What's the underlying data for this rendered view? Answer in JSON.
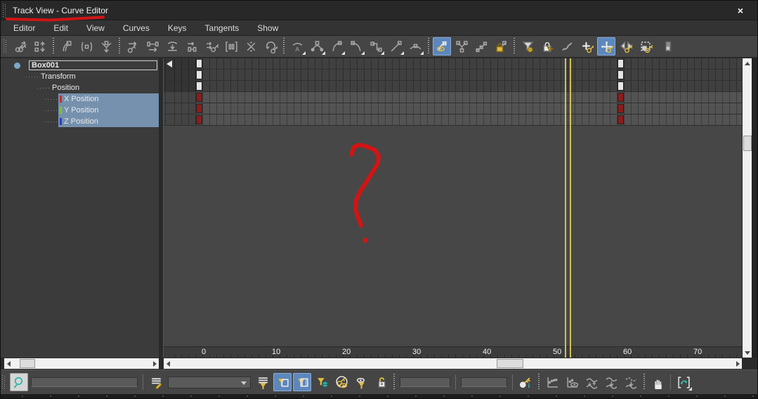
{
  "window": {
    "title": "Track View - Curve Editor",
    "close_label": "×"
  },
  "menu": {
    "items": [
      "Editor",
      "Edit",
      "View",
      "Curves",
      "Keys",
      "Tangents",
      "Show"
    ]
  },
  "toolbar_top": {
    "items": [
      {
        "t": "grip"
      },
      {
        "t": "btn",
        "name": "offset-keys",
        "icon": "key-arrow"
      },
      {
        "t": "btn",
        "name": "nudge-keys-vertical",
        "icon": "squares-ud"
      },
      {
        "t": "sep"
      },
      {
        "t": "btn",
        "name": "break-tangents-tool",
        "icon": "pliers"
      },
      {
        "t": "btn",
        "name": "snap-key-to-frame",
        "icon": "brace"
      },
      {
        "t": "btn",
        "name": "weld-keys",
        "icon": "v-arrow"
      },
      {
        "t": "sep"
      },
      {
        "t": "btn",
        "name": "slide-keys-horizontal",
        "icon": "arrows-lr-key"
      },
      {
        "t": "btn",
        "name": "scale-keys-time",
        "icon": "dumbbell-lr"
      },
      {
        "t": "btn",
        "name": "flatten-keys",
        "icon": "curve-flatten"
      },
      {
        "t": "btn",
        "name": "ease-keys",
        "icon": "arrow-dumbbell"
      },
      {
        "t": "btn",
        "name": "shift-keys",
        "icon": "arrows-keys"
      },
      {
        "t": "btn",
        "name": "region-keys-tool",
        "icon": "region"
      },
      {
        "t": "btn",
        "name": "randomize-keys",
        "icon": "x-arrows"
      },
      {
        "t": "btn",
        "name": "loop-keys",
        "icon": "loop"
      },
      {
        "t": "sep"
      },
      {
        "t": "btn",
        "name": "set-tangents-auto",
        "icon": "tan-auto",
        "flyout": true
      },
      {
        "t": "btn",
        "name": "set-tangents-spline",
        "icon": "tan-spline",
        "flyout": true
      },
      {
        "t": "btn",
        "name": "set-tangents-fast",
        "icon": "tan-fast",
        "flyout": true
      },
      {
        "t": "btn",
        "name": "set-tangents-slow",
        "icon": "tan-slow",
        "flyout": true
      },
      {
        "t": "btn",
        "name": "set-tangents-step",
        "icon": "tan-step",
        "flyout": true
      },
      {
        "t": "btn",
        "name": "set-tangents-linear",
        "icon": "tan-linear",
        "flyout": true
      },
      {
        "t": "btn",
        "name": "set-tangents-smooth",
        "icon": "tan-smooth",
        "flyout": true
      },
      {
        "t": "sep"
      },
      {
        "t": "btn",
        "name": "show-tangents-toggle",
        "icon": "eye-curve",
        "active": true
      },
      {
        "t": "btn",
        "name": "break-tangents",
        "icon": "y-tangent"
      },
      {
        "t": "btn",
        "name": "unify-tangents",
        "icon": "chain-diag"
      },
      {
        "t": "btn",
        "name": "lock-tangents-toggle",
        "icon": "lock-curve"
      },
      {
        "t": "sep"
      },
      {
        "t": "btn",
        "name": "filters",
        "icon": "funnel-gear"
      },
      {
        "t": "btn",
        "name": "lock-selection",
        "icon": "lock-cursor"
      },
      {
        "t": "btn",
        "name": "draw-curves",
        "icon": "squiggle"
      },
      {
        "t": "btn",
        "name": "add-keys",
        "icon": "plus-key"
      },
      {
        "t": "btn",
        "name": "move-keys",
        "icon": "move-cross",
        "active": true
      },
      {
        "t": "btn",
        "name": "slide-keys",
        "icon": "slide-tri"
      },
      {
        "t": "btn",
        "name": "scale-keys",
        "icon": "scale-marquee"
      },
      {
        "t": "btn",
        "name": "scale-values",
        "icon": "scale-values"
      }
    ]
  },
  "tree": {
    "items": [
      {
        "label": "Box001",
        "level": 0,
        "type": "object",
        "selected": false
      },
      {
        "label": "Transform",
        "level": 1,
        "type": "group",
        "selected": false
      },
      {
        "label": "Position",
        "level": 2,
        "type": "group",
        "selected": false
      },
      {
        "label": "X Position",
        "level": 3,
        "type": "track",
        "chip_color": "#cc2a2a",
        "selected": true
      },
      {
        "label": "Y Position",
        "level": 3,
        "type": "track",
        "chip_color": "#7dc242",
        "selected": true
      },
      {
        "label": "Z Position",
        "level": 3,
        "type": "track",
        "chip_color": "#2a3fcc",
        "selected": true
      }
    ]
  },
  "tracks": {
    "row_count": 6,
    "selected_rows": [
      3,
      4,
      5
    ],
    "key_frames": [
      0,
      60
    ],
    "key_color_plain": "#e6e6e6",
    "key_color_selected_track": "#8c1c1c"
  },
  "timeline": {
    "ticks": [
      "0",
      "10",
      "20",
      "30",
      "40",
      "50",
      "60",
      "70"
    ],
    "tick_frames": [
      0,
      10,
      20,
      30,
      40,
      50,
      60,
      70
    ]
  },
  "time_slider": {
    "frame": 52.5,
    "color": "#cfc04f"
  },
  "bottom_toolbar": {
    "items": [
      {
        "t": "grip"
      },
      {
        "t": "btn",
        "name": "zoom-selected-object",
        "icon": "magnifier",
        "light": true
      },
      {
        "t": "input",
        "name": "name-filter-input",
        "value": "",
        "width": 152
      },
      {
        "t": "div"
      },
      {
        "t": "btn",
        "name": "edit-track-sets",
        "icon": "lines-pencil"
      },
      {
        "t": "drop",
        "name": "track-sets-dropdown",
        "value": ""
      },
      {
        "t": "btn",
        "name": "filters-menu",
        "icon": "lines-funnel"
      },
      {
        "t": "btn",
        "name": "filter-selected-tracks-toggle",
        "icon": "funnel-rect",
        "active": true
      },
      {
        "t": "btn",
        "name": "filter-selected-objects-toggle",
        "icon": "funnel-frame",
        "active": true
      },
      {
        "t": "btn",
        "name": "filter-animated-tracks-toggle",
        "icon": "funnel-layers"
      },
      {
        "t": "btn",
        "name": "show-keyable-icons",
        "icon": "key-eye"
      },
      {
        "t": "btn",
        "name": "filter-visible-objects",
        "icon": "eye-funnel"
      },
      {
        "t": "btn",
        "name": "filter-unlocked-attributes",
        "icon": "lock-key"
      },
      {
        "t": "sep"
      },
      {
        "t": "input",
        "name": "key-time-field",
        "value": "",
        "width": 72
      },
      {
        "t": "div"
      },
      {
        "t": "input",
        "name": "key-value-field",
        "value": "",
        "width": 66
      },
      {
        "t": "div"
      },
      {
        "t": "btn",
        "name": "show-key-info",
        "icon": "key-info"
      },
      {
        "t": "sep"
      },
      {
        "t": "btn",
        "name": "frame-horizontal-extents",
        "icon": "axis-dots"
      },
      {
        "t": "btn",
        "name": "frame-horizontal-extents-keys",
        "icon": "axis-eye"
      },
      {
        "t": "btn",
        "name": "zoom-value-extents",
        "icon": "curve-updown"
      },
      {
        "t": "btn",
        "name": "zoom-value-extents-selected",
        "icon": "curve-down"
      },
      {
        "t": "btn",
        "name": "zoom-value-extents-range",
        "icon": "curve-down2"
      },
      {
        "t": "sep"
      },
      {
        "t": "btn",
        "name": "pan-tool",
        "icon": "hand"
      },
      {
        "t": "div"
      },
      {
        "t": "btn",
        "name": "zoom-region",
        "icon": "zoom-region",
        "flyout": true
      }
    ]
  },
  "annotations": {
    "color": "#d21414",
    "title_underline_points": "9,26 70,27.5 146,23.5",
    "question_mark_points": "499,219 503,208 511,205 522,208 533,213 538,221 537,231 530,243 521,257 512,271 506,284 505,297 509,310 513,320",
    "dot_cx": "519",
    "dot_cy": "341"
  },
  "colors": {
    "selection_blue": "#7591ad",
    "active_button_blue": "#5d87bb",
    "time_slider_yellow": "#cfc04f",
    "key_red": "#8c1c1c",
    "annotation_red": "#d21414",
    "graph_bg": "#474747"
  }
}
